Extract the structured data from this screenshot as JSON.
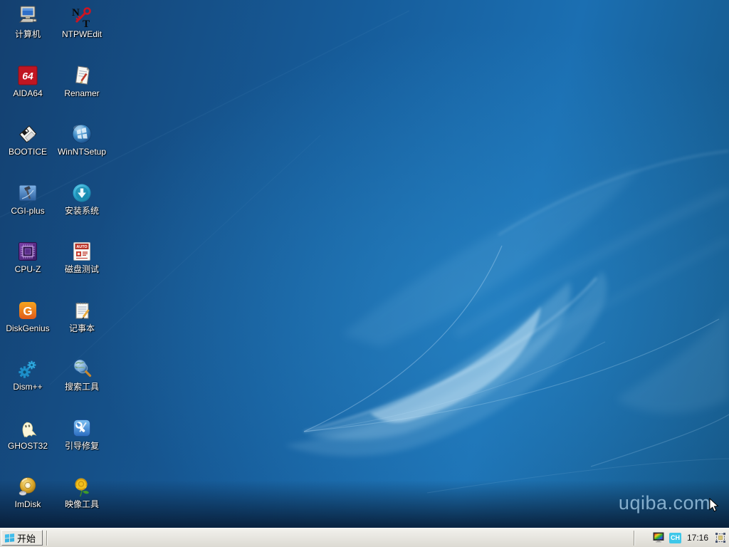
{
  "desktop": {
    "watermark": "uqiba.com",
    "icons": [
      {
        "label": "计算机",
        "icon": "computer-icon"
      },
      {
        "label": "NTPWEdit",
        "icon": "ntpwedit-key-icon"
      },
      {
        "label": "AIDA64",
        "icon": "aida64-icon"
      },
      {
        "label": "Renamer",
        "icon": "renamer-page-pencil-icon"
      },
      {
        "label": "BOOTICE",
        "icon": "floppy-disk-icon"
      },
      {
        "label": "WinNTSetup",
        "icon": "windows-sphere-icon"
      },
      {
        "label": "CGI-plus",
        "icon": "hammer-blue-square-icon"
      },
      {
        "label": "安装系统",
        "icon": "download-arrow-circle-icon"
      },
      {
        "label": "CPU-Z",
        "icon": "cpu-chip-icon"
      },
      {
        "label": "磁盘测试",
        "icon": "disk-test-auto-icon"
      },
      {
        "label": "DiskGenius",
        "icon": "diskgenius-g-icon"
      },
      {
        "label": "记事本",
        "icon": "notepad-pencil-icon"
      },
      {
        "label": "Dism++",
        "icon": "gears-icon"
      },
      {
        "label": "搜索工具",
        "icon": "globe-magnifier-icon"
      },
      {
        "label": "GHOST32",
        "icon": "ghost-icon"
      },
      {
        "label": "引导修复",
        "icon": "wrench-blue-square-icon"
      },
      {
        "label": "ImDisk",
        "icon": "gold-cd-icon"
      },
      {
        "label": "映像工具",
        "icon": "yellow-rose-icon"
      }
    ]
  },
  "taskbar": {
    "start_label": "开始",
    "start_icon": "windows-logo-icon",
    "clock": "17:16",
    "input_method_label": "CH",
    "tray_icons": [
      "display-settings-icon",
      "input-method-badge",
      "clock",
      "pecmd-selection-icon"
    ]
  },
  "colors": {
    "wallpaper_base": "#1b6fb2",
    "wallpaper_dark": "#144070",
    "taskbar_face": "#e9e7e1",
    "start_flag_blue": "#3fbdec",
    "input_badge_cyan": "#3ec7e9",
    "label_text": "#ffffff",
    "watermark_blue": "#a6cde9"
  }
}
